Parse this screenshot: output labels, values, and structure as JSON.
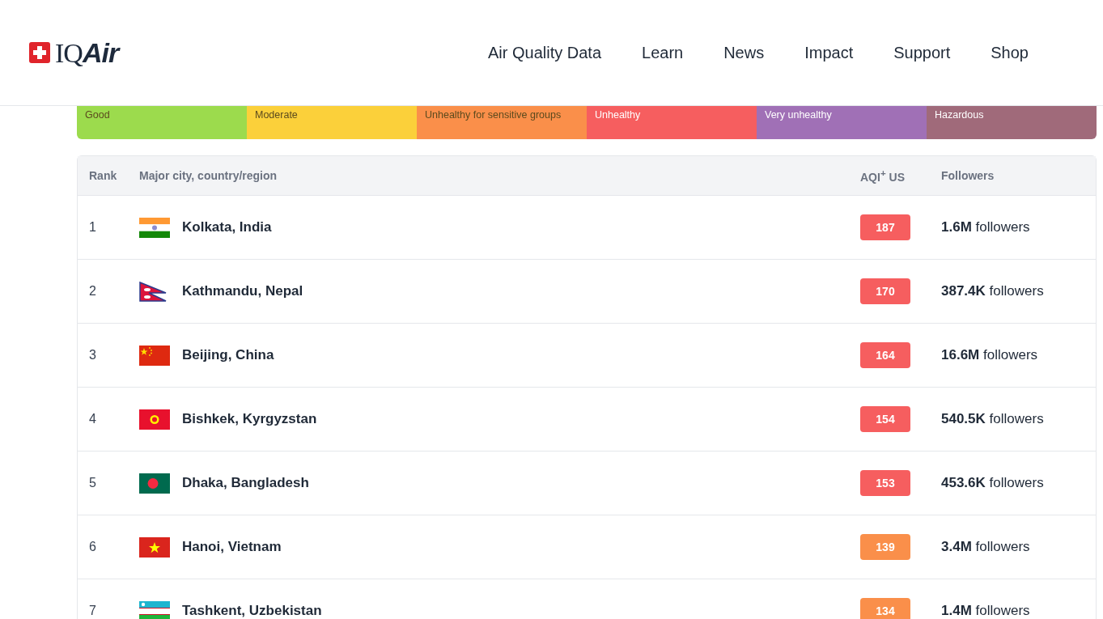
{
  "header": {
    "logo": {
      "plain": "IQ",
      "italic": "Air"
    },
    "nav": [
      "Air Quality Data",
      "Learn",
      "News",
      "Impact",
      "Support",
      "Shop"
    ]
  },
  "legend": [
    {
      "label": "Good",
      "color": "#9cdb4d"
    },
    {
      "label": "Moderate",
      "color": "#fbd03a"
    },
    {
      "label": "Unhealthy for sensitive groups",
      "color": "#fa8f4a"
    },
    {
      "label": "Unhealthy",
      "color": "#f65e5f"
    },
    {
      "label": "Very unhealthy",
      "color": "#a070b6"
    },
    {
      "label": "Hazardous",
      "color": "#a06a7a"
    }
  ],
  "table": {
    "columns": [
      "Rank",
      "Major city, country/region",
      "AQI$^{+}$ US",
      "Followers"
    ],
    "rows": [
      {
        "rank": "1",
        "city": "Kolkata, India",
        "aqi": "187",
        "color": "#f65e5f",
        "followers": "**1.6M** followers"
      },
      {
        "rank": "2",
        "city": "Kathmandu, Nepal",
        "aqi": "170",
        "color": "#f65e5f",
        "followers": "**387.4K** followers"
      },
      {
        "rank": "3",
        "city": "Beijing, China",
        "aqi": "164",
        "color": "#f65e5f",
        "followers": "**16.6M** followers"
      },
      {
        "rank": "4",
        "city": "Bishkek, Kyrgyzstan",
        "aqi": "154",
        "color": "#f65e5f",
        "followers": "**540.5K** followers"
      },
      {
        "rank": "5",
        "city": "Dhaka, Bangladesh",
        "aqi": "153",
        "color": "#f65e5f",
        "followers": "**453.6K** followers"
      },
      {
        "rank": "6",
        "city": "Hanoi, Vietnam",
        "aqi": "139",
        "color": "#fa8f4a",
        "followers": "**3.4M** followers"
      },
      {
        "rank": "7",
        "city": "Tashkent, Uzbekistan",
        "aqi": "134",
        "color": "#fa8f4a",
        "followers": "**1.4M** followers"
      }
    ]
  }
}
